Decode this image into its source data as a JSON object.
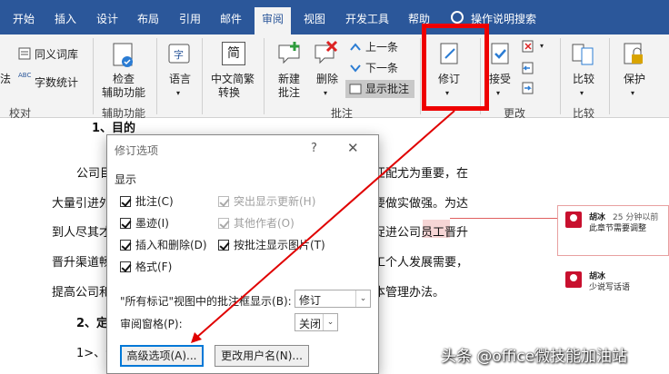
{
  "tabs": [
    "开始",
    "插入",
    "设计",
    "布局",
    "引用",
    "邮件",
    "审阅",
    "视图",
    "开发工具",
    "帮助",
    "操作说明搜索"
  ],
  "ribbon": {
    "proofing": {
      "thesaurus": "同义词库",
      "spell_prefix": "法",
      "abc": "ABC",
      "word_count": "字数统计",
      "group": "校对"
    },
    "accessibility": {
      "check": "检查",
      "assist": "辅助功能",
      "group": "辅助功能"
    },
    "language": {
      "label": "语言"
    },
    "chinese": {
      "icon_char": "简",
      "label": "中文简繁",
      "sub": "转换"
    },
    "comments": {
      "new": "新建",
      "new_sub": "批注",
      "delete": "删除",
      "prev": "上一条",
      "next": "下一条",
      "show": "显示批注",
      "group": "批注"
    },
    "tracking": {
      "label": "修订"
    },
    "changes": {
      "accept": "接受",
      "group": "更改"
    },
    "compare": {
      "label": "比较",
      "group": "比较"
    },
    "protect": {
      "label": "保护"
    }
  },
  "document": {
    "heading1": "1、目的",
    "lines": [
      "公司目",
      "匹配尤为重要，在",
      "大量引进外",
      "要做实做强。为达",
      "到人尽其才",
      "促进公司员工晋升",
      "晋升渠道畅",
      "工个人发展需要，",
      "提高公司和",
      "本管理办法。"
    ],
    "heading2": "2、定",
    "item1": "1>、晋"
  },
  "comments": [
    {
      "author": "胡冰",
      "time": "25 分钟以前",
      "text": "此章节需要调整"
    },
    {
      "author": "胡冰",
      "time": "",
      "text": "少说写话语"
    }
  ],
  "dialog": {
    "title": "修订选项",
    "help": "?",
    "close": "✕",
    "section": "显示",
    "checkboxes": {
      "comments": "批注(C)",
      "ink": "墨迹(I)",
      "insdel": "插入和删除(D)",
      "formatting": "格式(F)",
      "highlight": "突出显示更新(H)",
      "other_authors": "其他作者(O)",
      "pictures": "按批注显示图片(T)"
    },
    "balloons_label": "\"所有标记\"视图中的批注框显示(B):",
    "balloons_value": "修订",
    "pane_label": "审阅窗格(P):",
    "pane_value": "关闭",
    "advanced_button": "高级选项(A)...",
    "username_button": "更改用户名(N)..."
  },
  "watermark": "头条 @office微技能加油站",
  "colors": {
    "accent": "#2b579a",
    "annotation": "#e00000"
  }
}
